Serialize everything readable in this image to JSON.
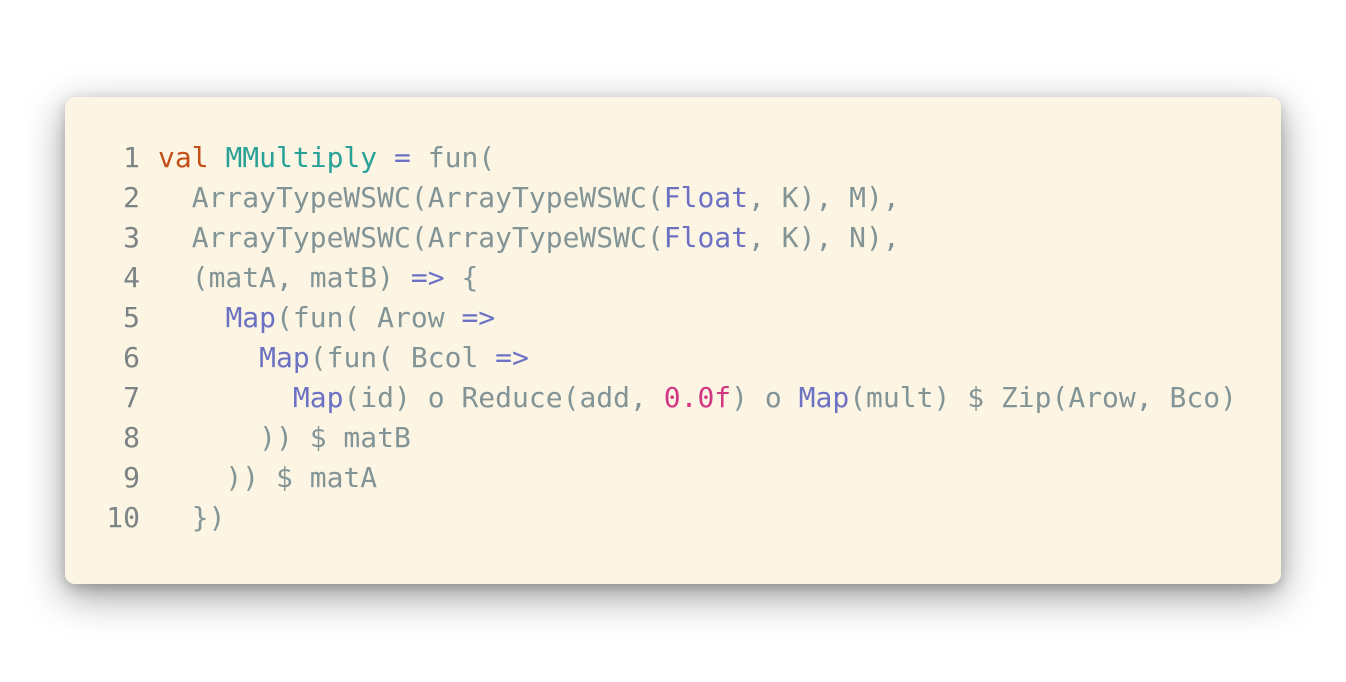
{
  "theme": {
    "background": "#fcf5e3",
    "colors": {
      "plain": "#839496",
      "keyword": "#c34f19",
      "definition": "#2aa198",
      "type": "#6c71c4",
      "number": "#d33682"
    }
  },
  "code": {
    "language": "scala",
    "lines": [
      {
        "number": "1",
        "tokens": [
          {
            "text": "val",
            "kind": "keyword"
          },
          {
            "text": " ",
            "kind": "plain"
          },
          {
            "text": "MMultiply",
            "kind": "def"
          },
          {
            "text": " ",
            "kind": "plain"
          },
          {
            "text": "=",
            "kind": "type"
          },
          {
            "text": " fun(",
            "kind": "plain"
          }
        ]
      },
      {
        "number": "2",
        "tokens": [
          {
            "text": "  ArrayTypeWSWC(ArrayTypeWSWC(",
            "kind": "plain"
          },
          {
            "text": "Float",
            "kind": "type"
          },
          {
            "text": ", K), M),",
            "kind": "plain"
          }
        ]
      },
      {
        "number": "3",
        "tokens": [
          {
            "text": "  ArrayTypeWSWC(ArrayTypeWSWC(",
            "kind": "plain"
          },
          {
            "text": "Float",
            "kind": "type"
          },
          {
            "text": ", K), N),",
            "kind": "plain"
          }
        ]
      },
      {
        "number": "4",
        "tokens": [
          {
            "text": "  (matA, matB) ",
            "kind": "plain"
          },
          {
            "text": "=>",
            "kind": "type"
          },
          {
            "text": " {",
            "kind": "plain"
          }
        ]
      },
      {
        "number": "5",
        "tokens": [
          {
            "text": "    ",
            "kind": "plain"
          },
          {
            "text": "Map",
            "kind": "type"
          },
          {
            "text": "(fun( Arow ",
            "kind": "plain"
          },
          {
            "text": "=>",
            "kind": "type"
          }
        ]
      },
      {
        "number": "6",
        "tokens": [
          {
            "text": "      ",
            "kind": "plain"
          },
          {
            "text": "Map",
            "kind": "type"
          },
          {
            "text": "(fun( Bcol ",
            "kind": "plain"
          },
          {
            "text": "=>",
            "kind": "type"
          }
        ]
      },
      {
        "number": "7",
        "tokens": [
          {
            "text": "        ",
            "kind": "plain"
          },
          {
            "text": "Map",
            "kind": "type"
          },
          {
            "text": "(id) o Reduce(add, ",
            "kind": "plain"
          },
          {
            "text": "0.0f",
            "kind": "number"
          },
          {
            "text": ") o ",
            "kind": "plain"
          },
          {
            "text": "Map",
            "kind": "type"
          },
          {
            "text": "(mult) $ Zip(Arow, Bco)",
            "kind": "plain"
          }
        ]
      },
      {
        "number": "8",
        "tokens": [
          {
            "text": "      )) $ matB",
            "kind": "plain"
          }
        ]
      },
      {
        "number": "9",
        "tokens": [
          {
            "text": "    )) $ matA",
            "kind": "plain"
          }
        ]
      },
      {
        "number": "10",
        "tokens": [
          {
            "text": "  })",
            "kind": "plain"
          }
        ]
      }
    ]
  }
}
